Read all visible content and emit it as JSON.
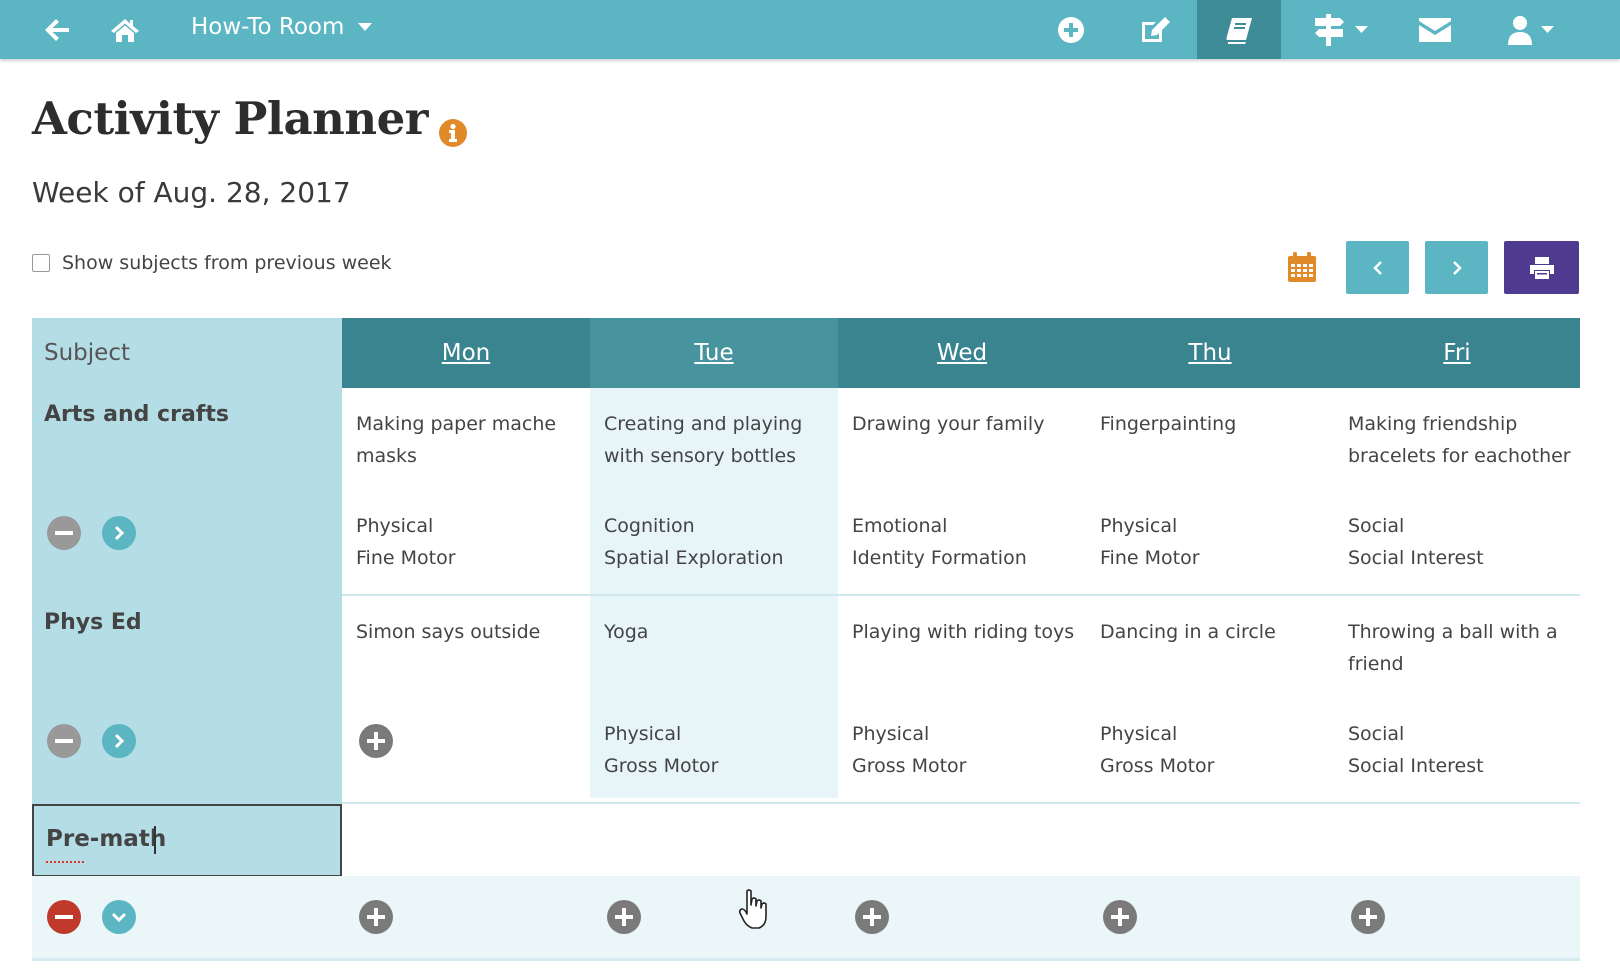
{
  "nav": {
    "back_icon": "arrow-left-icon",
    "home_icon": "home-icon",
    "room_label": "How-To Room",
    "icons": [
      "plus-circle-icon",
      "edit-icon",
      "book-icon",
      "signpost-icon",
      "envelope-icon",
      "user-icon"
    ]
  },
  "page": {
    "title": "Activity Planner",
    "subtitle": "Week of Aug. 28, 2017",
    "show_prev_label": "Show subjects from previous week"
  },
  "table": {
    "subject_header": "Subject",
    "days": [
      "Mon",
      "Tue",
      "Wed",
      "Thu",
      "Fri"
    ],
    "rows": [
      {
        "subject": "Arts and crafts",
        "cells": [
          {
            "activity": [
              "Making paper mache",
              "masks"
            ],
            "domain": "Physical",
            "skill": "Fine Motor"
          },
          {
            "activity": [
              "Creating and playing",
              "with sensory bottles"
            ],
            "domain": "Cognition",
            "skill": "Spatial Exploration"
          },
          {
            "activity": [
              "Drawing your family"
            ],
            "domain": "Emotional",
            "skill": "Identity Formation"
          },
          {
            "activity": [
              "Fingerpainting"
            ],
            "domain": "Physical",
            "skill": "Fine Motor"
          },
          {
            "activity": [
              "Making friendship",
              "bracelets for eachother"
            ],
            "domain": "Social",
            "skill": "Social Interest"
          }
        ]
      },
      {
        "subject": "Phys Ed",
        "cells": [
          {
            "activity": [
              "Simon says outside"
            ],
            "domain": "",
            "skill": ""
          },
          {
            "activity": [
              "Yoga"
            ],
            "domain": "Physical",
            "skill": "Gross Motor"
          },
          {
            "activity": [
              "Playing with riding toys"
            ],
            "domain": "Physical",
            "skill": "Gross Motor"
          },
          {
            "activity": [
              "Dancing in a circle"
            ],
            "domain": "Physical",
            "skill": "Gross Motor"
          },
          {
            "activity": [
              "Throwing a ball with a",
              "friend"
            ],
            "domain": "Social",
            "skill": "Social Interest"
          }
        ]
      }
    ],
    "new_subject_value": "Pre-math"
  },
  "colors": {
    "nav": "#5bb5c3",
    "nav_active": "#3f8c99",
    "header_day": "#3a848f",
    "subject_col": "#b5dde5",
    "print_button": "#4e3b8f",
    "info_icon": "#e08a2a",
    "remove_red": "#d9534f"
  }
}
